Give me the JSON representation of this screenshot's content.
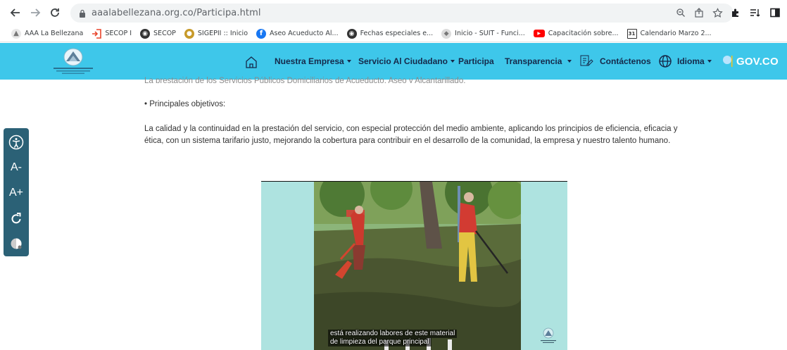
{
  "browser": {
    "url": "aaalabellezana.org.co/Participa.html",
    "back_icon": "arrow-left-icon",
    "forward_icon": "arrow-right-icon",
    "reload_icon": "reload-icon"
  },
  "bookmarks": [
    {
      "label": "AAA La Bellezana",
      "icon": "site-icon",
      "color": "#8a8a8a"
    },
    {
      "label": "SECOP I",
      "icon": "login-icon",
      "color": "#e8452c"
    },
    {
      "label": "SECOP",
      "icon": "globe-icon",
      "color": "#333333"
    },
    {
      "label": "SIGEPII :: Inicio",
      "icon": "seal-icon",
      "color": "#c79a2a"
    },
    {
      "label": "Aseo Acueducto Al...",
      "icon": "facebook-icon",
      "color": "#1877f2"
    },
    {
      "label": "Fechas especiales e...",
      "icon": "globe-icon",
      "color": "#333333"
    },
    {
      "label": "Inicio - SUIT - Funci...",
      "icon": "shield-icon",
      "color": "#8a8a8a"
    },
    {
      "label": "Capacitación sobre...",
      "icon": "youtube-icon",
      "color": "#ff0000"
    },
    {
      "label": "Calendario Marzo 2...",
      "icon": "calendar-icon",
      "color": "#333333"
    }
  ],
  "nav": {
    "items": [
      "Nuestra Empresa",
      "Servicio Al Ciudadano",
      "Participa",
      "Transparencia",
      "Contáctenos",
      "Idioma"
    ],
    "govco": "GOV.CO",
    "bg_color": "#3ec7ea",
    "text_color": "#15294a"
  },
  "content": {
    "cut_line": "La prestación de los Servicios Públicos Domiciliarios de Acueducto, Aseo y Alcantarillado.",
    "objectives_label": "• Principales objetivos:",
    "paragraph": "La calidad y la continuidad en la prestación del servicio, con especial protección del medio ambiente, aplicando los principios de eficiencia, eficacia y ética, con un sistema tarifario justo, mejorando la cobertura para contribuir en el desarrollo de la comunidad, la empresa y nuestro talento humano."
  },
  "video": {
    "caption_line1": "está realizando labores de este material",
    "caption_line2": "de limpieza del parque principal"
  },
  "a11y": {
    "decrease": "A-",
    "increase": "A+",
    "bg_color": "#2b6176"
  }
}
